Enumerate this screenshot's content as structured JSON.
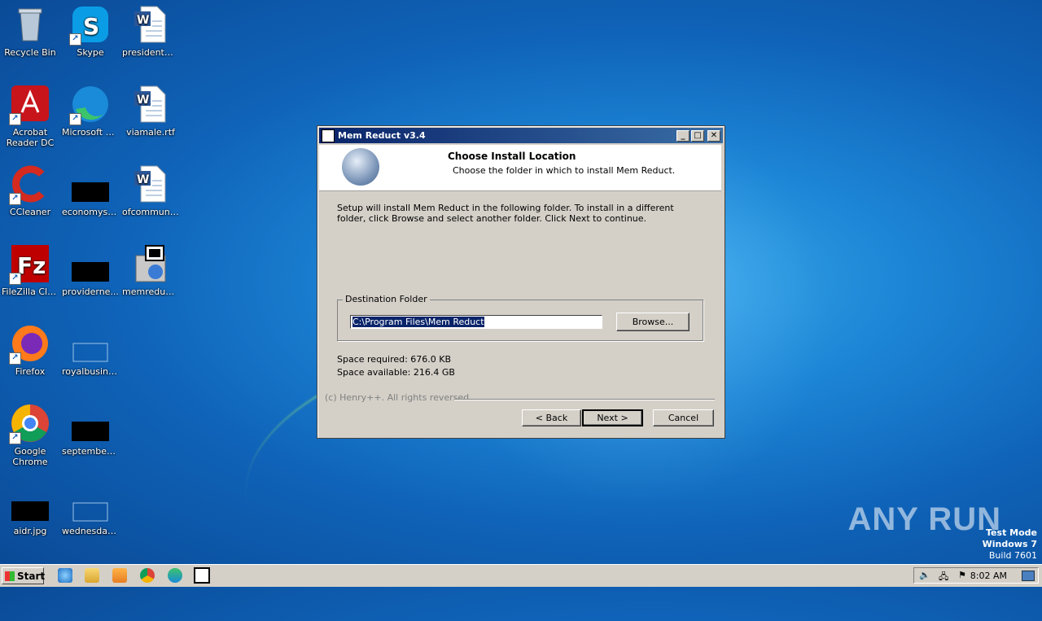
{
  "desktop": {
    "icons": [
      {
        "label": "Recycle Bin"
      },
      {
        "label": "Skype"
      },
      {
        "label": "presidentmr..."
      },
      {
        "label": "Acrobat Reader DC"
      },
      {
        "label": "Microsoft Edge"
      },
      {
        "label": "viamale.rtf"
      },
      {
        "label": "CCleaner"
      },
      {
        "label": "economystr..."
      },
      {
        "label": "ofcommunic..."
      },
      {
        "label": "FileZilla Client"
      },
      {
        "label": "providerne..."
      },
      {
        "label": "memreduct..."
      },
      {
        "label": "Firefox"
      },
      {
        "label": "royalbusine..."
      },
      {
        "label": "Google Chrome"
      },
      {
        "label": "septemberv..."
      },
      {
        "label": "aidr.jpg"
      },
      {
        "label": "wednesdayv..."
      }
    ]
  },
  "window": {
    "title": "Mem Reduct v3.4",
    "header": {
      "title": "Choose Install Location",
      "subtitle": "Choose the folder in which to install Mem Reduct."
    },
    "description": "Setup will install Mem Reduct in the following folder. To install in a different folder, click Browse and select another folder. Click Next to continue.",
    "destination": {
      "legend": "Destination Folder",
      "path": "C:\\Program Files\\Mem Reduct",
      "browse_label": "Browse..."
    },
    "space_required": "Space required: 676.0 KB",
    "space_available": "Space available: 216.4 GB",
    "copyright": "(c) Henry++. All rights reversed.",
    "buttons": {
      "back": "< Back",
      "next": "Next >",
      "cancel": "Cancel"
    }
  },
  "taskbar": {
    "start_label": "Start",
    "clock": "8:02 AM"
  },
  "watermark": "ANY RUN",
  "test_mode": {
    "line1": "Test Mode",
    "line2": "Windows 7",
    "line3": "Build 7601"
  }
}
